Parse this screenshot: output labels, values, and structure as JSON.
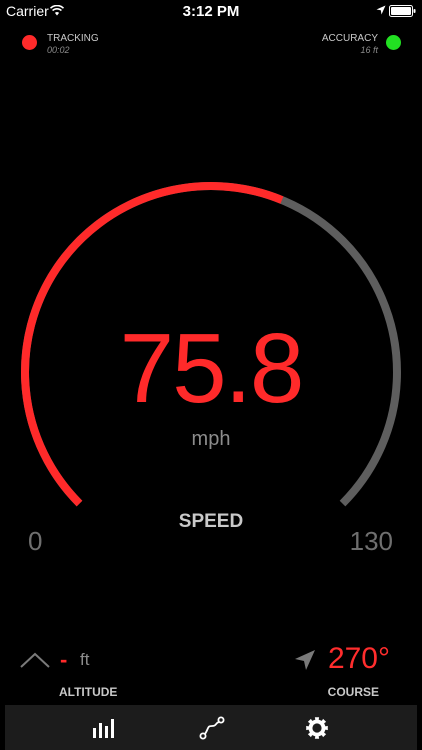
{
  "status_bar": {
    "carrier": "Carrier",
    "time": "3:12 PM",
    "icons": [
      "wifi-icon",
      "location-arrow-icon",
      "battery-icon"
    ]
  },
  "tracking": {
    "label": "TRACKING",
    "time": "00:02",
    "indicator_color": "#ff2a2a"
  },
  "accuracy": {
    "label": "ACCURACY",
    "value": "16 ft",
    "indicator_color": "#22e022"
  },
  "speed": {
    "value": "75.8",
    "unit": "mph",
    "label": "SPEED",
    "min": "0",
    "max": "130",
    "fill_fraction": 0.583,
    "color": "#ff2a2a",
    "track_color": "#5e5e5e"
  },
  "altitude": {
    "value": "-",
    "unit": "ft",
    "label": "ALTITUDE",
    "icon": "mountain-icon"
  },
  "course": {
    "value": "270°",
    "label": "COURSE",
    "icon": "heading-arrow-icon",
    "color": "#ff2d2d"
  },
  "tab_bar": {
    "tabs": [
      {
        "name": "stats",
        "icon": "bar-chart-icon"
      },
      {
        "name": "route",
        "icon": "route-icon"
      },
      {
        "name": "settings",
        "icon": "gear-icon"
      }
    ]
  }
}
